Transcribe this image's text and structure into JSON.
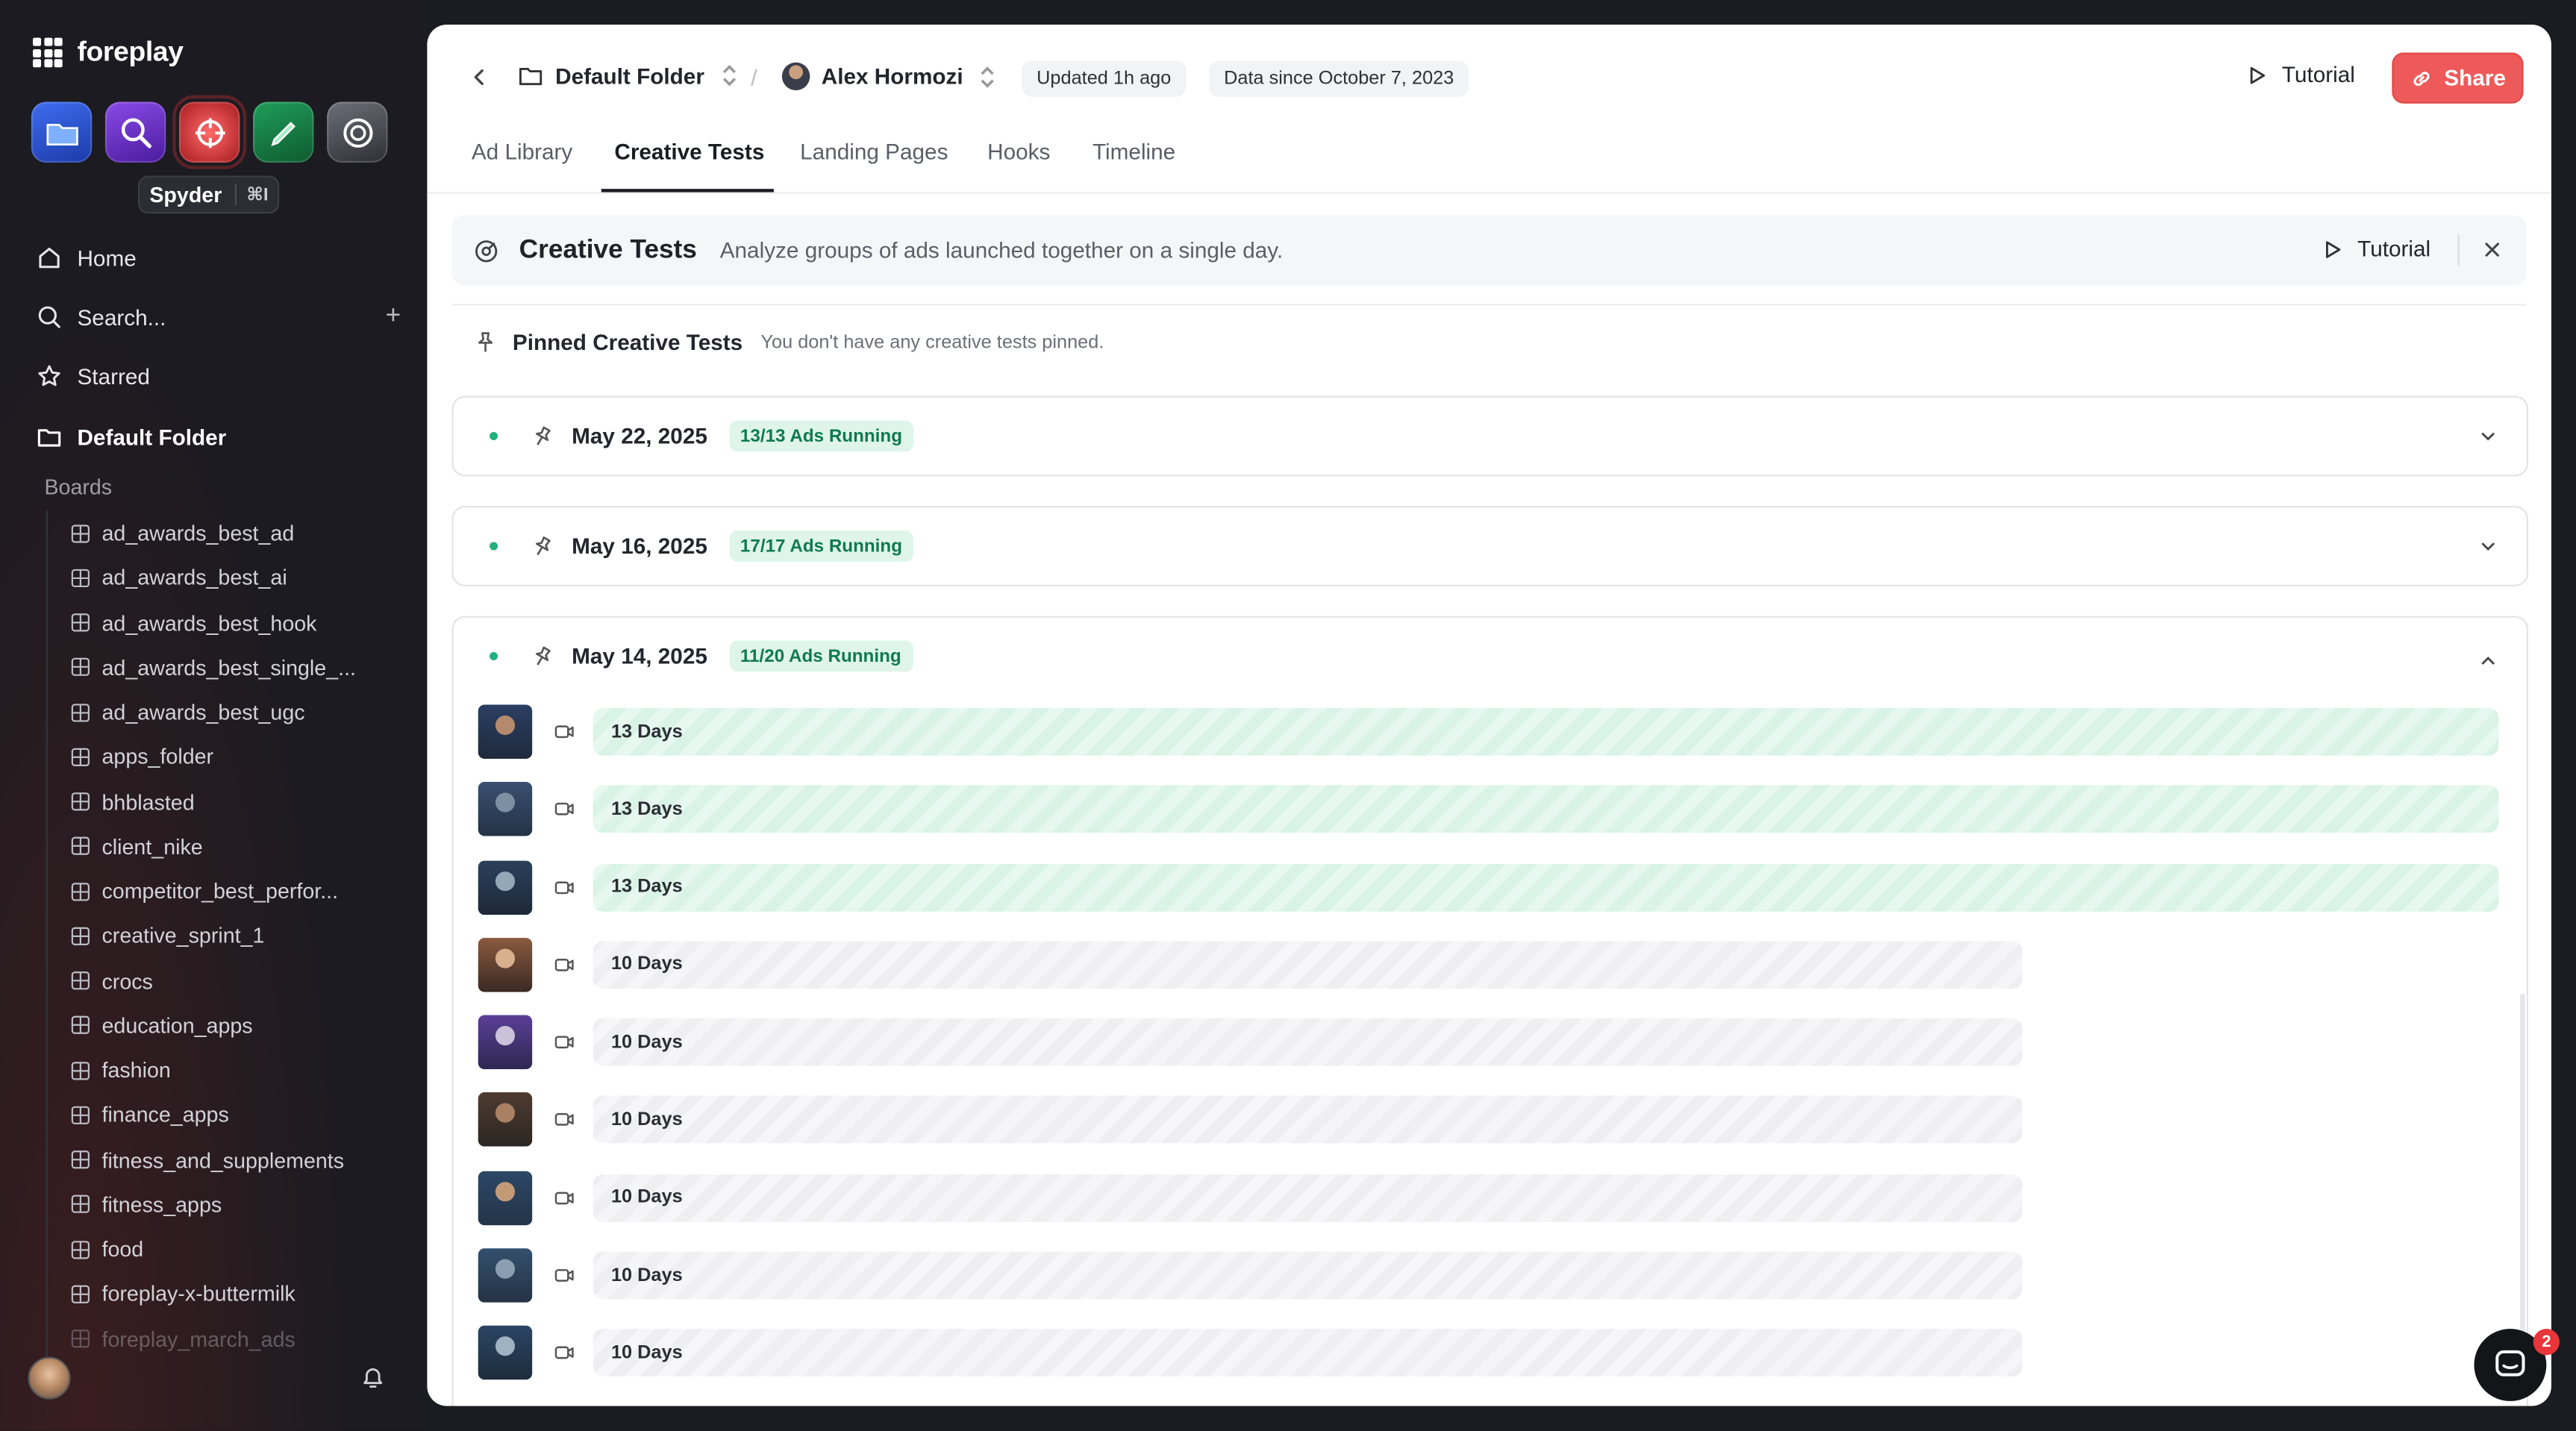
{
  "sidebar": {
    "brand": "foreplay",
    "tooltip": {
      "label": "Spyder",
      "shortcut": "⌘I"
    },
    "apps": [
      {
        "name": "library-app"
      },
      {
        "name": "discovery-app"
      },
      {
        "name": "spyder-app"
      },
      {
        "name": "briefs-app"
      },
      {
        "name": "lens-app"
      }
    ],
    "nav": {
      "home": "Home",
      "search": "Search...",
      "starred": "Starred",
      "folder": "Default Folder"
    },
    "boards_label": "Boards",
    "boards": [
      "ad_awards_best_ad",
      "ad_awards_best_ai",
      "ad_awards_best_hook",
      "ad_awards_best_single_...",
      "ad_awards_best_ugc",
      "apps_folder",
      "bhblasted",
      "client_nike",
      "competitor_best_perfor...",
      "creative_sprint_1",
      "crocs",
      "education_apps",
      "fashion",
      "finance_apps",
      "fitness_and_supplements",
      "fitness_apps",
      "food",
      "foreplay-x-buttermilk",
      "foreplay_march_ads"
    ]
  },
  "header": {
    "folder": "Default Folder",
    "brand": "Alex Hormozi",
    "updated": "Updated 1h ago",
    "data_since": "Data since October 7, 2023",
    "tutorial": "Tutorial",
    "share": "Share"
  },
  "tabs": [
    "Ad Library",
    "Creative Tests",
    "Landing Pages",
    "Hooks",
    "Timeline"
  ],
  "active_tab": "Creative Tests",
  "banner": {
    "title": "Creative Tests",
    "description": "Analyze groups of ads launched together on a single day.",
    "tutorial": "Tutorial"
  },
  "pinned": {
    "title": "Pinned Creative Tests",
    "note": "You don't have any creative tests pinned."
  },
  "groups": [
    {
      "date": "May 22, 2025",
      "badge": "13/13 Ads Running",
      "expanded": false
    },
    {
      "date": "May 16, 2025",
      "badge": "17/17 Ads Running",
      "expanded": false
    },
    {
      "date": "May 14, 2025",
      "badge": "11/20 Ads Running",
      "expanded": true,
      "ads": [
        {
          "label": "13 Days",
          "days": 13,
          "status": "running"
        },
        {
          "label": "13 Days",
          "days": 13,
          "status": "running"
        },
        {
          "label": "13 Days",
          "days": 13,
          "status": "running"
        },
        {
          "label": "10 Days",
          "days": 10,
          "status": "stopped"
        },
        {
          "label": "10 Days",
          "days": 10,
          "status": "stopped"
        },
        {
          "label": "10 Days",
          "days": 10,
          "status": "stopped"
        },
        {
          "label": "10 Days",
          "days": 10,
          "status": "stopped"
        },
        {
          "label": "10 Days",
          "days": 10,
          "status": "stopped"
        },
        {
          "label": "10 Days",
          "days": 10,
          "status": "stopped"
        }
      ]
    }
  ],
  "chat": {
    "unread": "2"
  },
  "colors": {
    "accent": "#ee5a5a",
    "running": "#22b07d",
    "running_bar": "#d9f3e6",
    "stopped_bar": "#efeff2"
  }
}
